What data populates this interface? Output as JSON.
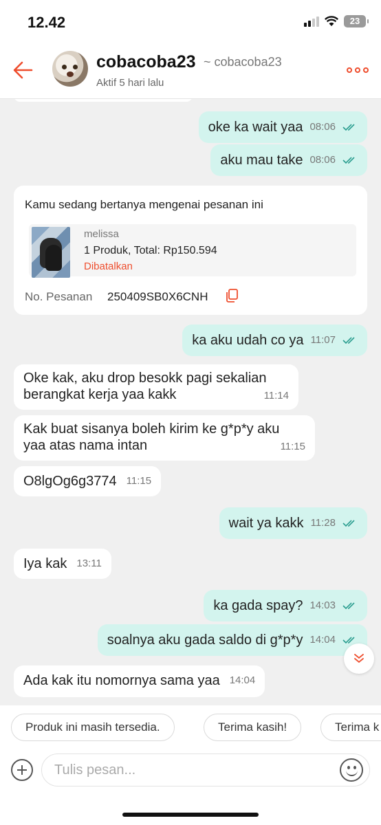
{
  "status_bar": {
    "time": "12.42",
    "battery": "23"
  },
  "header": {
    "name": "cobacoba23",
    "username": "~ cobacoba23",
    "active_status": "Aktif 5 hari lalu"
  },
  "colors": {
    "accent": "#ee4d2d",
    "outgoing_bubble": "#d3f4ee",
    "tick": "#2a9d8f"
  },
  "messages": [
    {
      "dir": "out",
      "text": "oke ka wait yaa",
      "time": "08:06"
    },
    {
      "dir": "out",
      "text": "aku mau take",
      "time": "08:06"
    },
    {
      "dir": "out",
      "text": "ka aku udah co ya",
      "time": "11:07"
    },
    {
      "dir": "in",
      "text": "Oke kak, aku drop besokk pagi sekalian berangkat kerja yaa kakk",
      "time": "11:14"
    },
    {
      "dir": "in",
      "text": "Kak buat sisanya boleh kirim ke g*p*y aku yaa atas nama intan",
      "time": "11:15"
    },
    {
      "dir": "in",
      "text": "O8lgOg6g3774",
      "time": "11:15"
    },
    {
      "dir": "out",
      "text": "wait ya kakk",
      "time": "11:28"
    },
    {
      "dir": "in",
      "text": "Iya kak",
      "time": "13:11"
    },
    {
      "dir": "out",
      "text": "ka gada spay?",
      "time": "14:03"
    },
    {
      "dir": "out",
      "text": "soalnya aku gada saldo di g*p*y",
      "time": "14:04"
    },
    {
      "dir": "in",
      "text": "Ada kak itu nomornya sama yaa",
      "time": "14:04"
    }
  ],
  "order_card": {
    "title": "Kamu sedang bertanya mengenai pesanan ini",
    "shop": "melissa",
    "summary": "1 Produk, Total: Rp150.594",
    "status": "Dibatalkan",
    "order_no_label": "No. Pesanan",
    "order_no": "250409SB0X6CNH"
  },
  "quick_replies": [
    "Produk ini masih tersedia.",
    "Terima kasih!",
    "Terima k"
  ],
  "input": {
    "placeholder": "Tulis pesan..."
  },
  "icons": [
    "back-arrow-icon",
    "more-options-icon",
    "double-check-icon",
    "copy-icon",
    "chevron-down-icon",
    "plus-icon",
    "emoji-icon"
  ]
}
